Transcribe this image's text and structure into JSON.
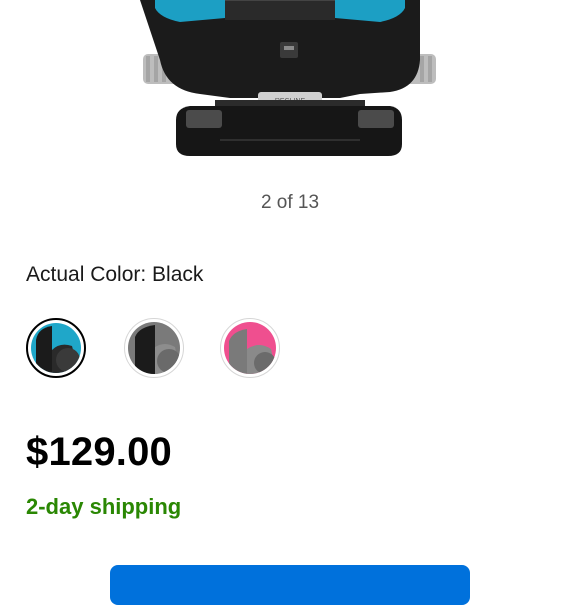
{
  "gallery": {
    "counter_text": "2 of 13",
    "image_label": "RECLINE"
  },
  "color_selector": {
    "label": "Actual Color: Black",
    "swatches": [
      {
        "name": "Black",
        "accent": "#1fa7c9",
        "selected": true
      },
      {
        "name": "Gray",
        "accent": "#2a2a2a",
        "selected": false
      },
      {
        "name": "Pink",
        "accent": "#ef4f8f",
        "selected": false
      }
    ]
  },
  "pricing": {
    "price": "$129.00"
  },
  "shipping": {
    "text": "2-day shipping",
    "color": "#2a8703"
  },
  "action_button": {
    "color": "#0071dc"
  }
}
